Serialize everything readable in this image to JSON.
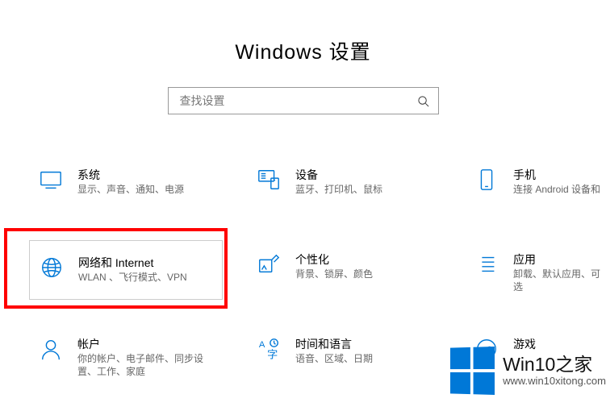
{
  "title": "Windows 设置",
  "search": {
    "placeholder": "查找设置"
  },
  "tiles": {
    "system": {
      "title": "系统",
      "desc": "显示、声音、通知、电源"
    },
    "devices": {
      "title": "设备",
      "desc": "蓝牙、打印机、鼠标"
    },
    "phone": {
      "title": "手机",
      "desc": "连接 Android 设备和"
    },
    "network": {
      "title": "网络和 Internet",
      "desc": "WLAN 、飞行模式、VPN"
    },
    "personal": {
      "title": "个性化",
      "desc": "背景、锁屏、颜色"
    },
    "apps": {
      "title": "应用",
      "desc": "卸载、默认应用、可选"
    },
    "accounts": {
      "title": "帐户",
      "desc": "你的帐户、电子邮件、同步设置、工作、家庭"
    },
    "time": {
      "title": "时间和语言",
      "desc": "语音、区域、日期"
    },
    "gaming": {
      "title": "游戏",
      "desc": ""
    }
  },
  "watermark": {
    "title": "Win10之家",
    "sub": "www.win10xitong.com"
  },
  "accent": "#0078D7"
}
